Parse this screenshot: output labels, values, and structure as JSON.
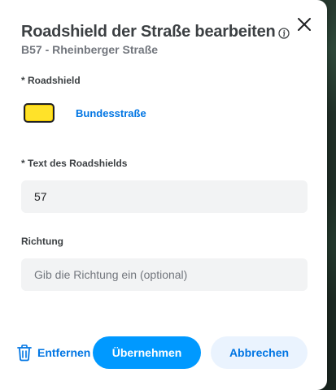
{
  "dialog": {
    "title": "Roadshield der Straße bearbeiten",
    "subtitle": "B57 - Rheinberger Straße"
  },
  "roadshield": {
    "label": "* Roadshield",
    "selected_name": "Bundesstraße",
    "shield_fill": "#ffe229",
    "shield_border": "#202124"
  },
  "shield_text": {
    "label": "* Text des Roadshields",
    "value": "57"
  },
  "direction": {
    "label": "Richtung",
    "value": "",
    "placeholder": "Gib die Richtung ein (optional)"
  },
  "actions": {
    "delete_label": "Entfernen",
    "apply_label": "Übernehmen",
    "cancel_label": "Abbrechen"
  },
  "colors": {
    "primary": "#0099ff",
    "link": "#0075e3",
    "secondary_bg": "#eaf3fe"
  },
  "icons": [
    "info-icon",
    "close-icon",
    "trash-icon"
  ]
}
